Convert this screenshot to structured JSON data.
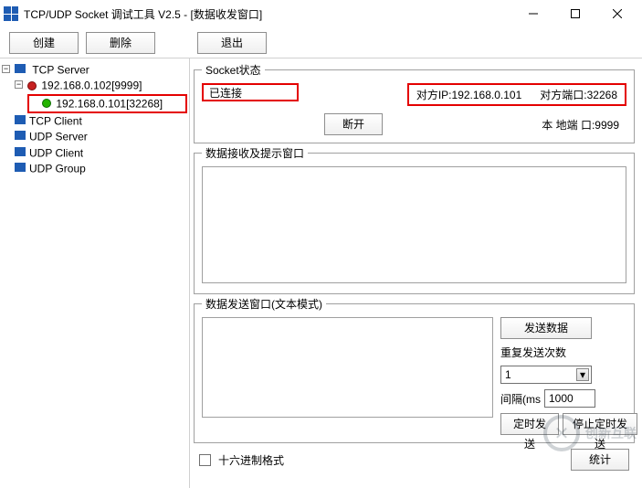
{
  "title": "TCP/UDP Socket 调试工具 V2.5 - [数据收发窗口]",
  "toolbar": {
    "create": "创建",
    "delete": "删除",
    "quit": "退出"
  },
  "tree": {
    "tcp_server": "TCP Server",
    "listener": "192.168.0.102[9999]",
    "connection": "192.168.0.101[32268]",
    "tcp_client": "TCP Client",
    "udp_server": "UDP Server",
    "udp_client": "UDP Client",
    "udp_group": "UDP Group"
  },
  "socket": {
    "legend": "Socket状态",
    "status": "已连接",
    "peer_ip_label": "对方IP:",
    "peer_ip": "192.168.0.101",
    "peer_port_label": "对方端口:",
    "peer_port": "32268",
    "disconnect": "断开",
    "local_port_label": "本 地端 口:",
    "local_port": "9999"
  },
  "recv": {
    "legend": "数据接收及提示窗口",
    "text": ""
  },
  "send": {
    "legend": "数据发送窗口(文本模式)",
    "text": "",
    "send_btn": "发送数据",
    "repeat_label": "重复发送次数",
    "repeat_value": "1",
    "interval_label": "间隔(ms",
    "interval_value": "1000",
    "timer_send": "定时发送",
    "stop_timer": "停止定时发送"
  },
  "bottom": {
    "hex_label": "十六进制格式",
    "stats": "统计"
  },
  "watermark": "创新互联"
}
